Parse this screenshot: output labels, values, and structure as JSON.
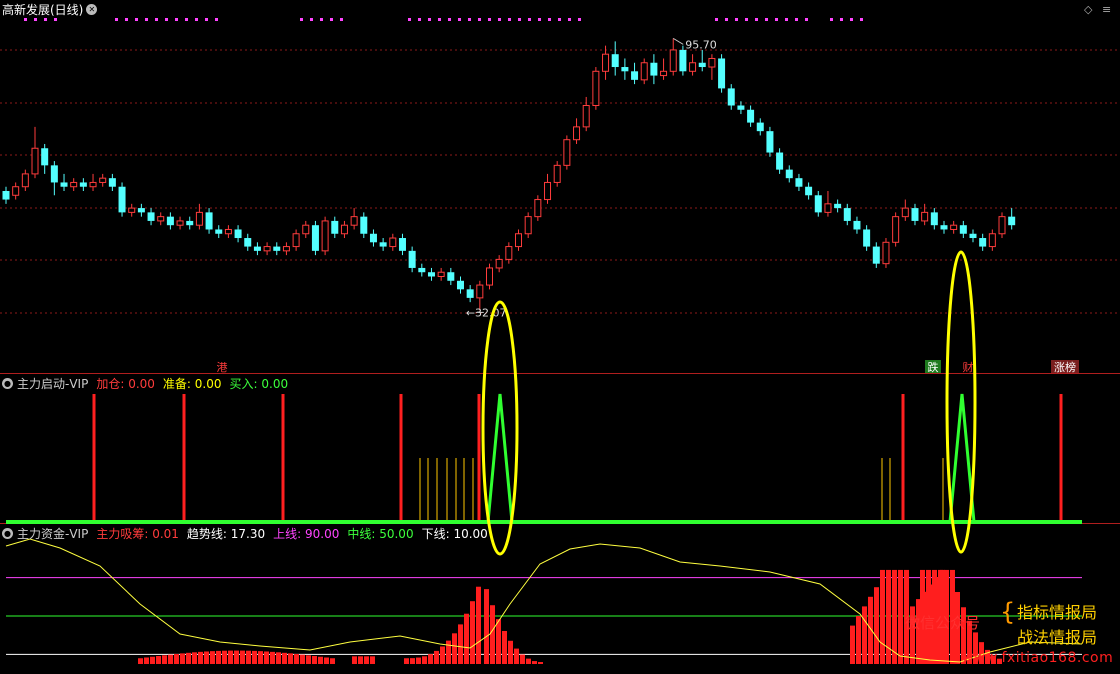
{
  "window": {
    "title": "高新发展(日线)",
    "diamond_icon": "diamond-icon",
    "close_icon": "close-icon"
  },
  "main_chart": {
    "high_label": "95.70",
    "low_label": "32.07",
    "tags": [
      {
        "text": "港",
        "color": "#ff3c3c"
      },
      {
        "text": "跌",
        "color": "#ffffff",
        "bg": "#1e7a1e"
      },
      {
        "text": "财",
        "color": "#ff3c3c"
      },
      {
        "text": "涨榜",
        "color": "#ffffff",
        "bg": "#7a1e1e"
      }
    ],
    "price_range": [
      20,
      100
    ],
    "candles": [
      [
        60,
        58,
        61,
        57
      ],
      [
        59,
        61,
        62,
        58
      ],
      [
        61,
        64,
        65,
        60
      ],
      [
        64,
        70,
        75,
        63
      ],
      [
        70,
        66,
        71,
        64
      ],
      [
        66,
        62,
        67,
        59
      ],
      [
        62,
        61,
        64,
        60
      ],
      [
        61,
        62,
        63,
        60
      ],
      [
        62,
        61,
        63,
        60
      ],
      [
        61,
        62,
        64,
        60
      ],
      [
        62,
        63,
        64,
        61
      ],
      [
        63,
        61,
        64,
        60
      ],
      [
        61,
        55,
        62,
        54
      ],
      [
        55,
        56,
        57,
        54
      ],
      [
        56,
        55,
        57,
        54
      ],
      [
        55,
        53,
        56,
        52
      ],
      [
        53,
        54,
        55,
        52
      ],
      [
        54,
        52,
        55,
        51
      ],
      [
        52,
        53,
        54,
        51
      ],
      [
        53,
        52,
        54,
        51
      ],
      [
        52,
        55,
        57,
        51
      ],
      [
        55,
        51,
        56,
        50
      ],
      [
        51,
        50,
        52,
        49
      ],
      [
        50,
        51,
        52,
        49
      ],
      [
        51,
        49,
        52,
        48
      ],
      [
        49,
        47,
        50,
        46
      ],
      [
        47,
        46,
        48,
        45
      ],
      [
        46,
        47,
        48,
        45
      ],
      [
        47,
        46,
        48,
        45
      ],
      [
        46,
        47,
        48,
        45
      ],
      [
        47,
        50,
        51,
        46
      ],
      [
        50,
        52,
        53,
        49
      ],
      [
        52,
        46,
        53,
        45
      ],
      [
        46,
        53,
        54,
        45
      ],
      [
        53,
        50,
        54,
        49
      ],
      [
        50,
        52,
        53,
        49
      ],
      [
        52,
        54,
        56,
        51
      ],
      [
        54,
        50,
        55,
        49
      ],
      [
        50,
        48,
        51,
        47
      ],
      [
        48,
        47,
        49,
        46
      ],
      [
        47,
        49,
        50,
        46
      ],
      [
        49,
        46,
        50,
        45
      ],
      [
        46,
        42,
        47,
        41
      ],
      [
        42,
        41,
        43,
        40
      ],
      [
        41,
        40,
        42,
        39
      ],
      [
        40,
        41,
        42,
        39
      ],
      [
        41,
        39,
        42,
        38
      ],
      [
        39,
        37,
        40,
        36
      ],
      [
        37,
        35,
        38,
        34
      ],
      [
        35,
        38,
        39,
        32.07
      ],
      [
        38,
        42,
        43,
        37
      ],
      [
        42,
        44,
        45,
        41
      ],
      [
        44,
        47,
        48,
        43
      ],
      [
        47,
        50,
        51,
        46
      ],
      [
        50,
        54,
        55,
        49
      ],
      [
        54,
        58,
        59,
        53
      ],
      [
        58,
        62,
        64,
        57
      ],
      [
        62,
        66,
        67,
        61
      ],
      [
        66,
        72,
        73,
        65
      ],
      [
        72,
        75,
        77,
        71
      ],
      [
        75,
        80,
        82,
        74
      ],
      [
        80,
        88,
        89,
        79
      ],
      [
        88,
        92,
        94,
        86
      ],
      [
        92,
        89,
        95,
        87
      ],
      [
        89,
        88,
        91,
        86
      ],
      [
        88,
        86,
        90,
        85
      ],
      [
        86,
        90,
        91,
        85
      ],
      [
        90,
        87,
        92,
        85
      ],
      [
        87,
        88,
        91,
        86
      ],
      [
        88,
        93,
        95.7,
        87
      ],
      [
        93,
        88,
        94,
        87
      ],
      [
        88,
        90,
        92,
        87
      ],
      [
        90,
        89,
        93,
        88
      ],
      [
        89,
        91,
        92,
        86
      ],
      [
        91,
        84,
        92,
        83
      ],
      [
        84,
        80,
        85,
        79
      ],
      [
        80,
        79,
        81,
        78
      ],
      [
        79,
        76,
        80,
        75
      ],
      [
        76,
        74,
        77,
        73
      ],
      [
        74,
        69,
        75,
        68
      ],
      [
        69,
        65,
        70,
        64
      ],
      [
        65,
        63,
        66,
        62
      ],
      [
        63,
        61,
        64,
        60
      ],
      [
        61,
        59,
        62,
        58
      ],
      [
        59,
        55,
        60,
        54
      ],
      [
        55,
        57,
        60,
        54
      ],
      [
        57,
        56,
        58,
        55
      ],
      [
        56,
        53,
        57,
        52
      ],
      [
        53,
        51,
        54,
        50
      ],
      [
        51,
        47,
        52,
        46
      ],
      [
        47,
        43,
        48,
        42
      ],
      [
        43,
        48,
        49,
        42
      ],
      [
        48,
        54,
        55,
        47
      ],
      [
        54,
        56,
        58,
        53
      ],
      [
        56,
        53,
        57,
        52
      ],
      [
        53,
        55,
        57,
        52
      ],
      [
        55,
        52,
        56,
        51
      ],
      [
        52,
        51,
        53,
        50
      ],
      [
        51,
        52,
        53,
        50
      ],
      [
        52,
        50,
        53,
        49
      ],
      [
        50,
        49,
        51,
        48
      ],
      [
        49,
        47,
        50,
        46
      ],
      [
        47,
        50,
        51,
        46
      ],
      [
        50,
        54,
        55,
        49
      ],
      [
        54,
        52,
        56,
        51
      ]
    ]
  },
  "indicator1": {
    "title": "主力启动-VIP",
    "items": [
      {
        "label": "加仓:",
        "value": "0.00",
        "color": "#ff3c3c"
      },
      {
        "label": "准备:",
        "value": "0.00",
        "color": "#ffff00"
      },
      {
        "label": "买入:",
        "value": "0.00",
        "color": "#3cff3c"
      }
    ],
    "red_bars": [
      94,
      184,
      283,
      401,
      479,
      903,
      1061
    ],
    "yellow_bars": [
      420,
      428,
      437,
      447,
      456,
      464,
      473,
      882,
      890,
      943
    ],
    "spikes": [
      500,
      962
    ]
  },
  "indicator2": {
    "title": "主力资金-VIP",
    "items": [
      {
        "label": "主力吸筹:",
        "value": "0.01",
        "color": "#ff3c3c"
      },
      {
        "label": "趋势线:",
        "value": "17.30",
        "color": "#ffffff"
      },
      {
        "label": "上线:",
        "value": "90.00",
        "color": "#ff44ff"
      },
      {
        "label": "中线:",
        "value": "50.00",
        "color": "#3cff3c"
      },
      {
        "label": "下线:",
        "value": "10.00",
        "color": "#ffffff"
      }
    ]
  },
  "watermark": {
    "left": "微信公众号",
    "line1": "指标情报局",
    "line2": "战法情报局",
    "url": "www.fxitiao168.com"
  },
  "colors": {
    "up": "#ff3c3c",
    "down": "#54ffff",
    "grid": "#8b1a1a",
    "ellipse": "#ffff00"
  }
}
